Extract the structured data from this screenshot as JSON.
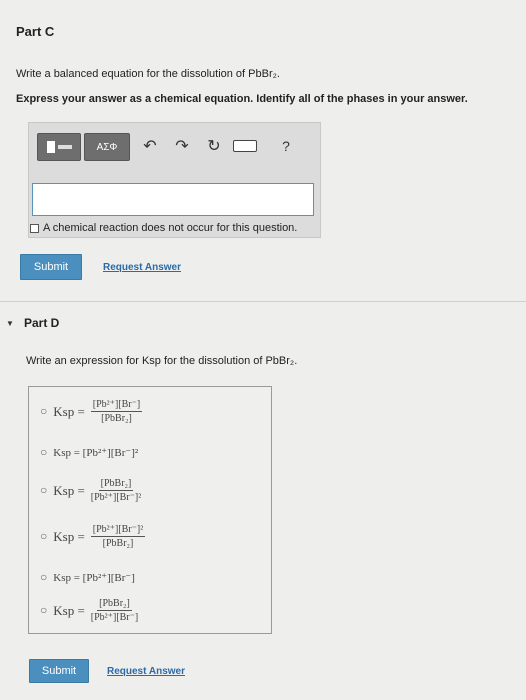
{
  "part_c": {
    "title": "Part C",
    "question": "Write a balanced equation for the dissolution of PbBr₂.",
    "instruction": "Express your answer as a chemical equation. Identify all of the phases in your answer.",
    "toolbar": {
      "template_label": "",
      "greek_label": "ΑΣΦ",
      "help_label": "?"
    },
    "answer_value": "",
    "no_reaction_label": "A chemical reaction does not occur for this question.",
    "submit_label": "Submit",
    "request_label": "Request Answer"
  },
  "part_d": {
    "title": "Part D",
    "question": "Write an expression for Ksp for the dissolution of PbBr₂.",
    "options": [
      {
        "lhs": "Ksp =",
        "num": "[Pb²⁺][Br⁻]",
        "den": "[PbBr₂]"
      },
      {
        "text": "Ksp = [Pb²⁺][Br⁻]²"
      },
      {
        "lhs": "Ksp =",
        "num": "[PbBr₂]",
        "den": "[Pb²⁺][Br⁻]²"
      },
      {
        "lhs": "Ksp =",
        "num": "[Pb²⁺][Br⁻]²",
        "den": "[PbBr₂]"
      },
      {
        "text": "Ksp = [Pb²⁺][Br⁻]"
      },
      {
        "lhs": "Ksp =",
        "num": "[PbBr₂]",
        "den": "[Pb²⁺][Br⁻]"
      }
    ],
    "submit_label": "Submit",
    "request_label": "Request Answer"
  }
}
